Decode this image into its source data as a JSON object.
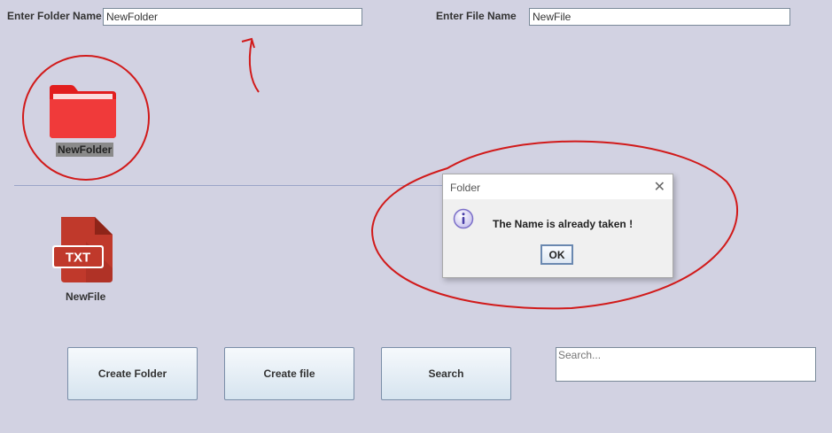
{
  "form": {
    "folder_label": "Enter Folder Name",
    "folder_value": "NewFolder",
    "file_label": "Enter File Name",
    "file_value": "NewFile"
  },
  "items": {
    "folder": {
      "label": "NewFolder",
      "icon": "folder-icon",
      "color": "#e8312f"
    },
    "file": {
      "label": "NewFile",
      "icon": "txt-file-icon",
      "badge": "TXT",
      "color": "#c0392b"
    }
  },
  "buttons": {
    "create_folder": "Create Folder",
    "create_file": "Create file",
    "search": "Search"
  },
  "search": {
    "placeholder": "Search..."
  },
  "dialog": {
    "title": "Folder",
    "message": "The Name is already taken !",
    "ok": "OK",
    "icon": "info-icon"
  },
  "colors": {
    "background": "#d2d2e2",
    "annotation": "#d11a1a",
    "info_icon": "#7b6fc8"
  }
}
